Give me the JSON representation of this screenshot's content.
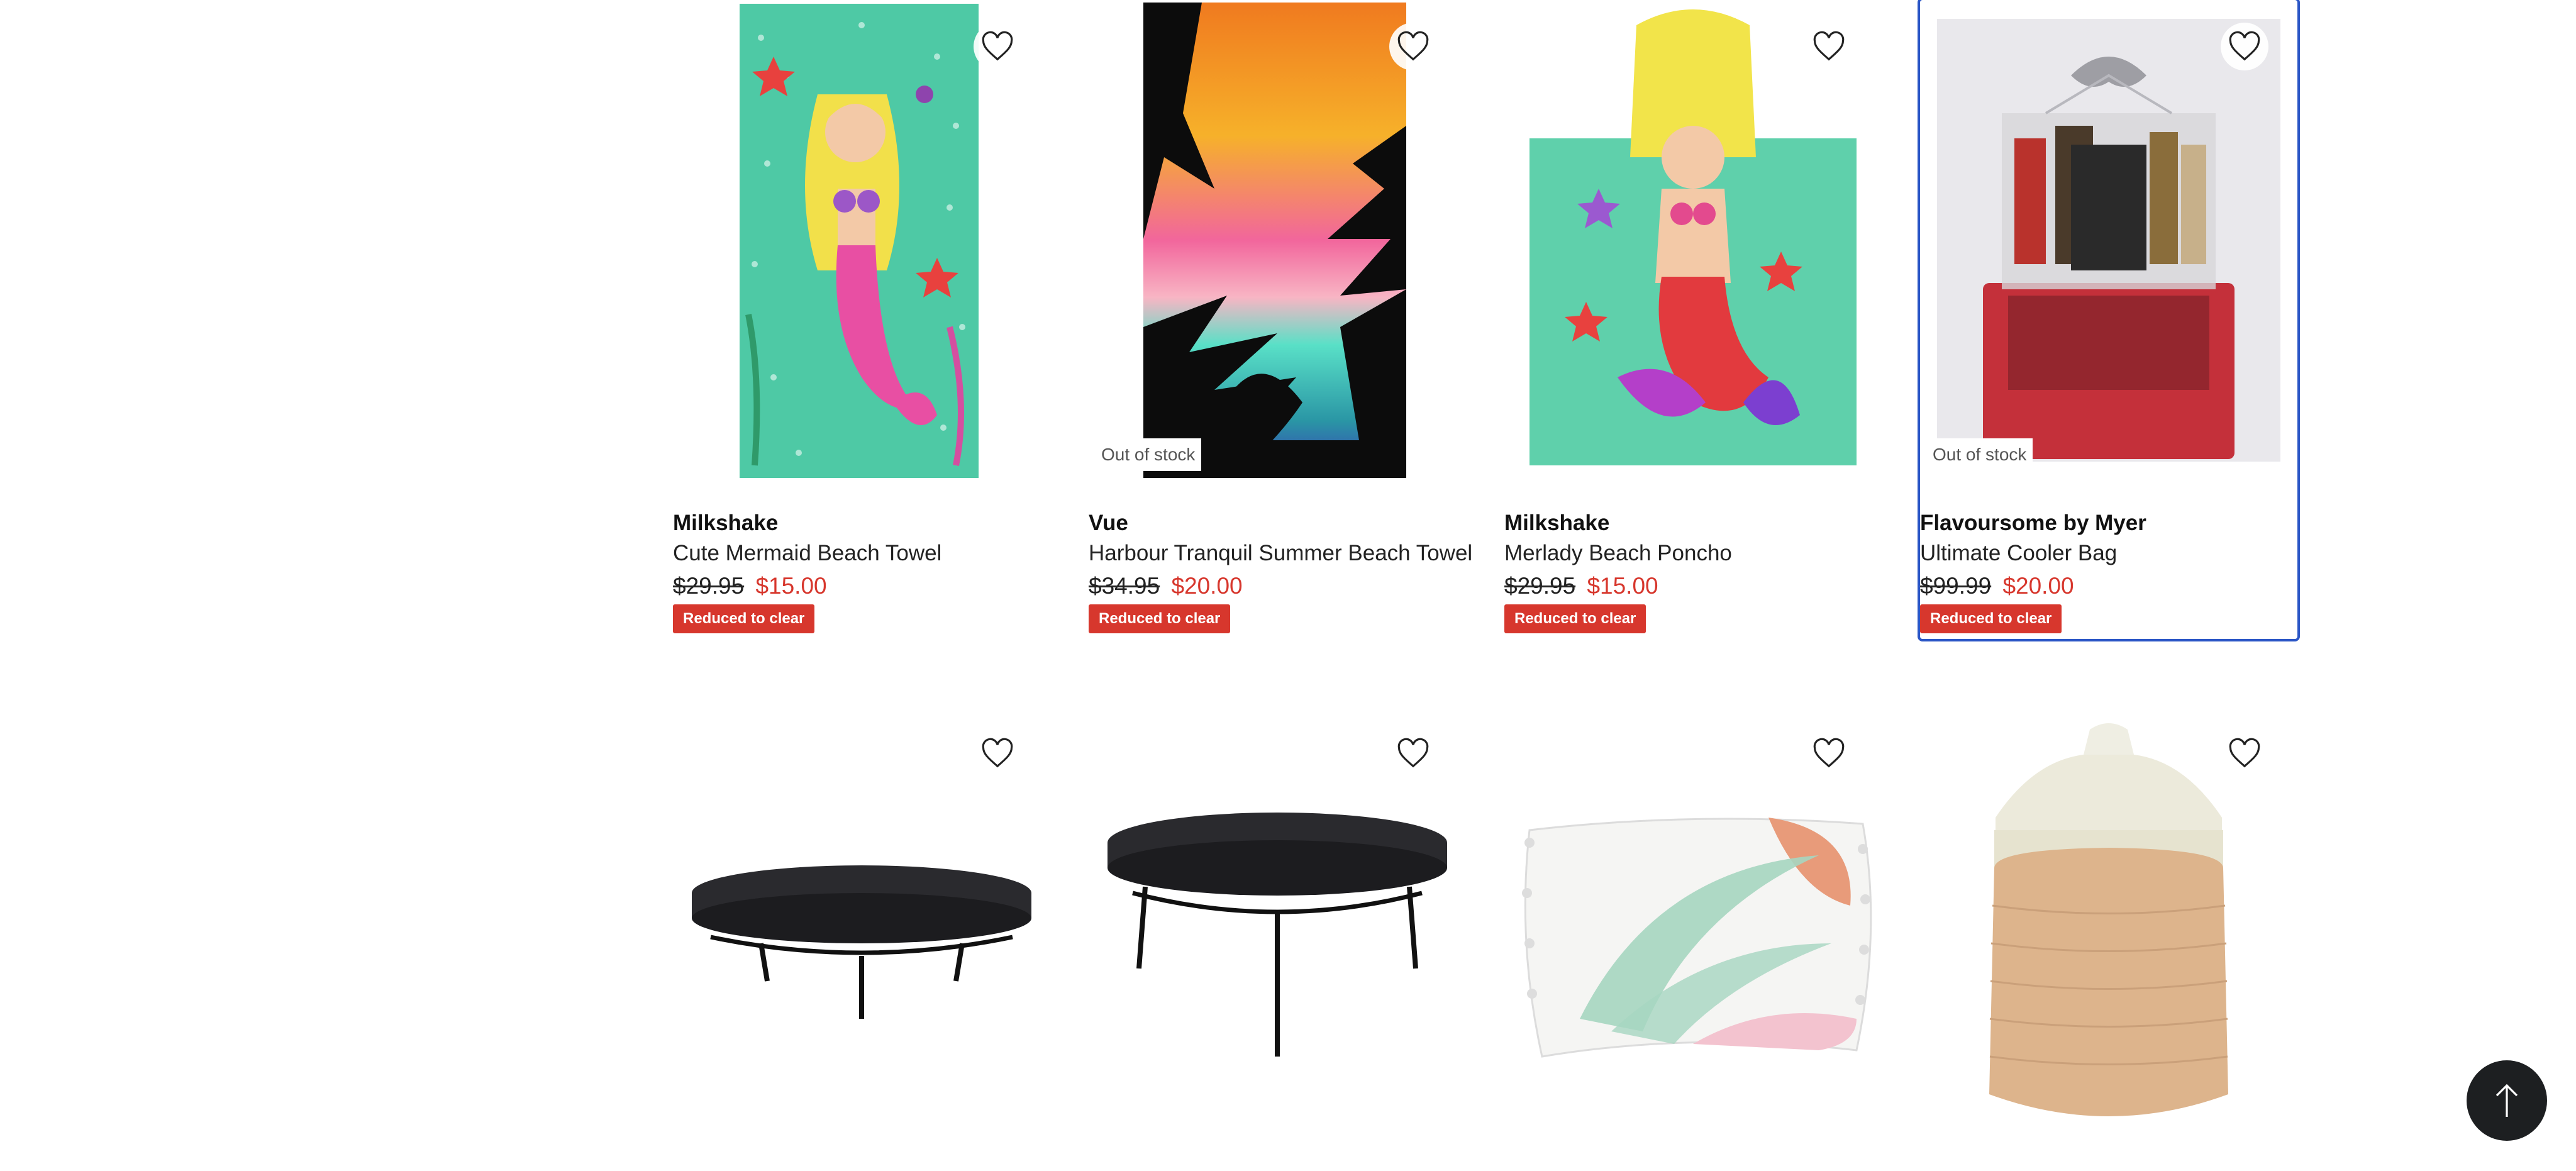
{
  "products_row1": [
    {
      "brand": "Milkshake",
      "name": "Cute Mermaid Beach Towel",
      "was_price": "$29.95",
      "now_price": "$15.00",
      "badge": "Reduced to clear",
      "out_of_stock": ""
    },
    {
      "brand": "Vue",
      "name": "Harbour Tranquil Summer Beach Towel",
      "was_price": "$34.95",
      "now_price": "$20.00",
      "badge": "Reduced to clear",
      "out_of_stock": "Out of stock"
    },
    {
      "brand": "Milkshake",
      "name": "Merlady Beach Poncho",
      "was_price": "$29.95",
      "now_price": "$15.00",
      "badge": "Reduced to clear",
      "out_of_stock": ""
    },
    {
      "brand": "Flavoursome by Myer",
      "name": "Ultimate Cooler Bag",
      "was_price": "$99.99",
      "now_price": "$20.00",
      "badge": "Reduced to clear",
      "out_of_stock": "Out of stock"
    }
  ],
  "products_row2": [
    {
      "image": "low-marble-stand"
    },
    {
      "image": "tall-black-stand"
    },
    {
      "image": "leaf-cushion"
    },
    {
      "image": "ceramic-canister"
    }
  ],
  "icons": {
    "wishlist": "heart-outline-icon",
    "back_to_top": "arrow-up-icon"
  },
  "colors": {
    "sale_red": "#d7372d",
    "selected_outline": "#2b56c6",
    "back_to_top_bg": "#1d1f21"
  }
}
